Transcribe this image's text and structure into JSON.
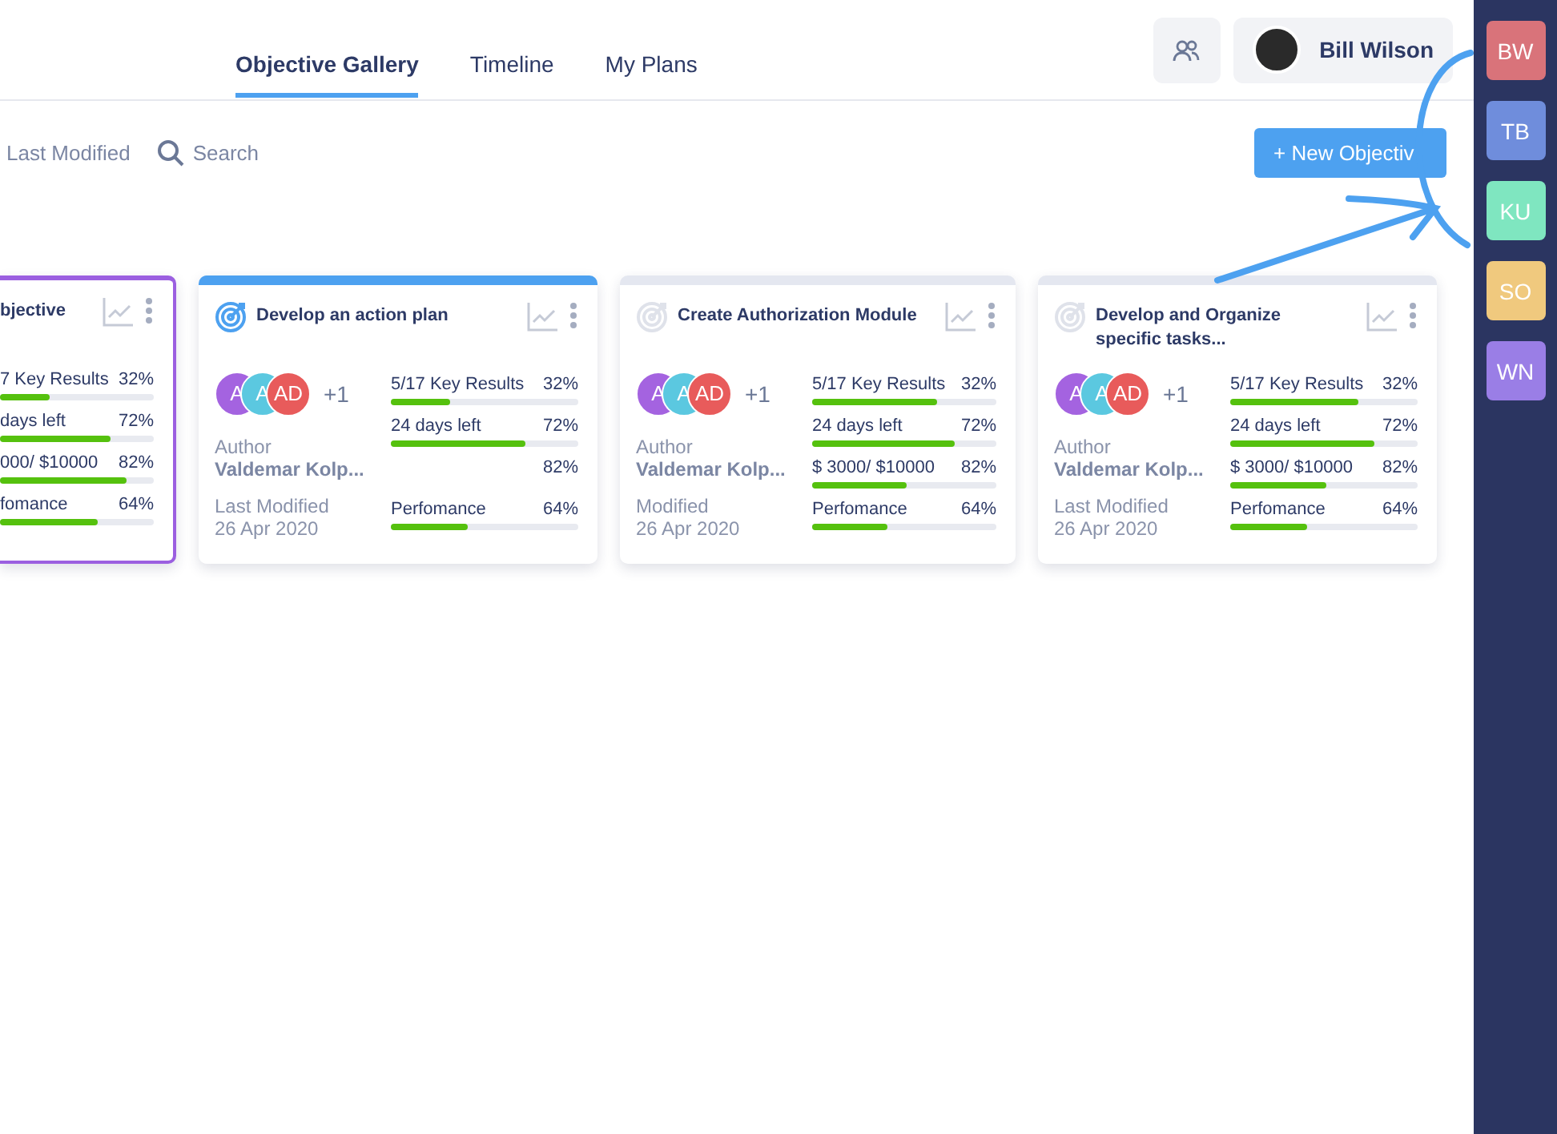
{
  "header": {
    "tabs": [
      {
        "label": "Objective Gallery",
        "selected": true
      },
      {
        "label": "Timeline",
        "selected": false
      },
      {
        "label": "My Plans",
        "selected": false
      }
    ],
    "user": {
      "name": "Bill Wilson"
    }
  },
  "toolbar": {
    "sort": "Last Modified",
    "search": {
      "placeholder": "Search"
    },
    "new_button": "+ New Objectiv"
  },
  "cards": [
    {
      "title": "bjective",
      "cut": true,
      "selected": true,
      "color": "#9b5fe0",
      "metrics": [
        {
          "label": "7 Key Results",
          "value": "32%",
          "level": 0.32
        },
        {
          "label": "days left",
          "value": "72%",
          "level": 0.72
        },
        {
          "label": "000/ $10000",
          "value": "82%",
          "level": 0.82
        },
        {
          "label": "fomance",
          "value": "64%",
          "level": 0.64
        }
      ]
    },
    {
      "title": "Develop an action plan",
      "cut": false,
      "selected": false,
      "color": "#4da1f0",
      "avatars": [
        {
          "initials": "A",
          "color": "#a463e0"
        },
        {
          "initials": "A",
          "color": "#5bc8e0"
        },
        {
          "initials": "AD",
          "color": "#e85b5b"
        }
      ],
      "more": "+1",
      "author_label": "Author",
      "author": "Valdemar Kolp...",
      "modified_label": "Last Modified",
      "modified": "26 Apr 2020",
      "metrics": [
        {
          "label": "5/17 Key Results",
          "value": "32%",
          "level": 0.32
        },
        {
          "label": "24 days left",
          "value": "72%",
          "level": 0.72
        },
        {
          "value": "82%"
        },
        {
          "label": "Perfomance",
          "value": "64%",
          "level": 0.41
        }
      ]
    },
    {
      "title": "Create Authorization Module",
      "cut": false,
      "selected": false,
      "color": "#e4e7f0",
      "avatars": [
        {
          "initials": "A",
          "color": "#a463e0"
        },
        {
          "initials": "A",
          "color": "#5bc8e0"
        },
        {
          "initials": "AD",
          "color": "#e85b5b"
        }
      ],
      "more": "+1",
      "author_label": "Author",
      "author": "Valdemar Kolp...",
      "modified_label": "Modified",
      "modified": "26 Apr 2020",
      "metrics": [
        {
          "label": "5/17 Key Results",
          "value": "32%",
          "level": 0.68
        },
        {
          "label": "24 days left",
          "value": "72%",
          "level": 0.77
        },
        {
          "label": "$ 3000/ $10000",
          "value": "82%",
          "level": 0.51
        },
        {
          "label": "Perfomance",
          "value": "64%",
          "level": 0.41
        }
      ]
    },
    {
      "title": "Develop and Organize specific tasks...",
      "cut": false,
      "selected": false,
      "color": "#e4e7f0",
      "avatars": [
        {
          "initials": "A",
          "color": "#a463e0"
        },
        {
          "initials": "A",
          "color": "#5bc8e0"
        },
        {
          "initials": "AD",
          "color": "#e85b5b"
        }
      ],
      "more": "+1",
      "author_label": "Author",
      "author": "Valdemar Kolp...",
      "modified_label": "Last Modified",
      "modified": "26 Apr 2020",
      "metrics": [
        {
          "label": "5/17 Key Results",
          "value": "32%",
          "level": 0.68
        },
        {
          "label": "24 days left",
          "value": "72%",
          "level": 0.77
        },
        {
          "label": "$ 3000/ $10000",
          "value": "82%",
          "level": 0.51
        },
        {
          "label": "Perfomance",
          "value": "64%",
          "level": 0.41
        }
      ]
    }
  ],
  "sidebar": {
    "users": [
      {
        "initials": "BW",
        "color": "#d9737a"
      },
      {
        "initials": "TB",
        "color": "#6f8ddc"
      },
      {
        "initials": "KU",
        "color": "#7fe6c0"
      },
      {
        "initials": "SO",
        "color": "#f0c97e"
      },
      {
        "initials": "WN",
        "color": "#9a7ee6"
      }
    ]
  }
}
